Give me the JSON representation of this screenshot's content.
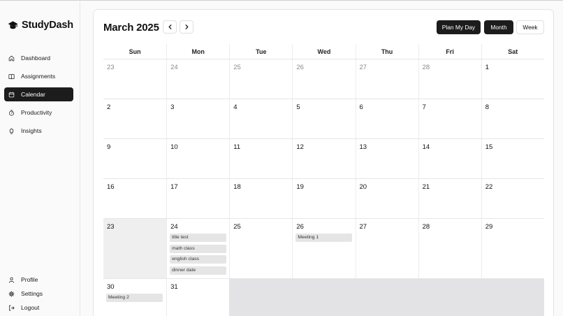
{
  "brand": {
    "name": "StudyDash",
    "icon": "graduation-cap-icon"
  },
  "nav": [
    {
      "label": "Dashboard",
      "icon": "home-icon",
      "active": false
    },
    {
      "label": "Assignments",
      "icon": "book-icon",
      "active": false
    },
    {
      "label": "Calendar",
      "icon": "calendar-icon",
      "active": true
    },
    {
      "label": "Productivity",
      "icon": "timer-icon",
      "active": false
    },
    {
      "label": "Insights",
      "icon": "lightbulb-icon",
      "active": false
    }
  ],
  "bottom_nav": [
    {
      "label": "Profile",
      "icon": "user-icon"
    },
    {
      "label": "Settings",
      "icon": "gear-icon"
    },
    {
      "label": "Logout",
      "icon": "logout-icon"
    }
  ],
  "calendar": {
    "title": "March 2025",
    "prev_icon": "chevron-left-icon",
    "next_icon": "chevron-right-icon",
    "buttons": {
      "plan": "Plan My Day",
      "month": "Month",
      "week": "Week"
    },
    "active_view": "Month",
    "weekdays": [
      "Sun",
      "Mon",
      "Tue",
      "Wed",
      "Thu",
      "Fri",
      "Sat"
    ],
    "weeks": [
      [
        {
          "day": "23",
          "other": true
        },
        {
          "day": "24",
          "other": true
        },
        {
          "day": "25",
          "other": true
        },
        {
          "day": "26",
          "other": true
        },
        {
          "day": "27",
          "other": true
        },
        {
          "day": "28",
          "other": true
        },
        {
          "day": "1"
        }
      ],
      [
        {
          "day": "2"
        },
        {
          "day": "3"
        },
        {
          "day": "4"
        },
        {
          "day": "5"
        },
        {
          "day": "6"
        },
        {
          "day": "7"
        },
        {
          "day": "8"
        }
      ],
      [
        {
          "day": "9"
        },
        {
          "day": "10"
        },
        {
          "day": "11"
        },
        {
          "day": "12"
        },
        {
          "day": "13"
        },
        {
          "day": "14"
        },
        {
          "day": "15"
        }
      ],
      [
        {
          "day": "16"
        },
        {
          "day": "17"
        },
        {
          "day": "18"
        },
        {
          "day": "19"
        },
        {
          "day": "20"
        },
        {
          "day": "21"
        },
        {
          "day": "22"
        }
      ],
      [
        {
          "day": "23",
          "today": true
        },
        {
          "day": "24",
          "events": [
            "title test",
            "math class",
            "english class",
            "dinner date"
          ]
        },
        {
          "day": "25"
        },
        {
          "day": "26",
          "events": [
            "Meeting 1"
          ]
        },
        {
          "day": "27"
        },
        {
          "day": "28"
        },
        {
          "day": "29"
        }
      ],
      [
        {
          "day": "30",
          "events": [
            "Meeting 2"
          ]
        },
        {
          "day": "31"
        },
        {
          "void": true
        },
        {
          "void": true
        },
        {
          "void": true
        },
        {
          "void": true
        },
        {
          "void": true
        }
      ]
    ]
  },
  "colors": {
    "accent_dark": "#1c1c1c",
    "event_bg": "#e5e5e5",
    "today_bg": "#efefef",
    "empty_bg": "#e3e3e6"
  }
}
